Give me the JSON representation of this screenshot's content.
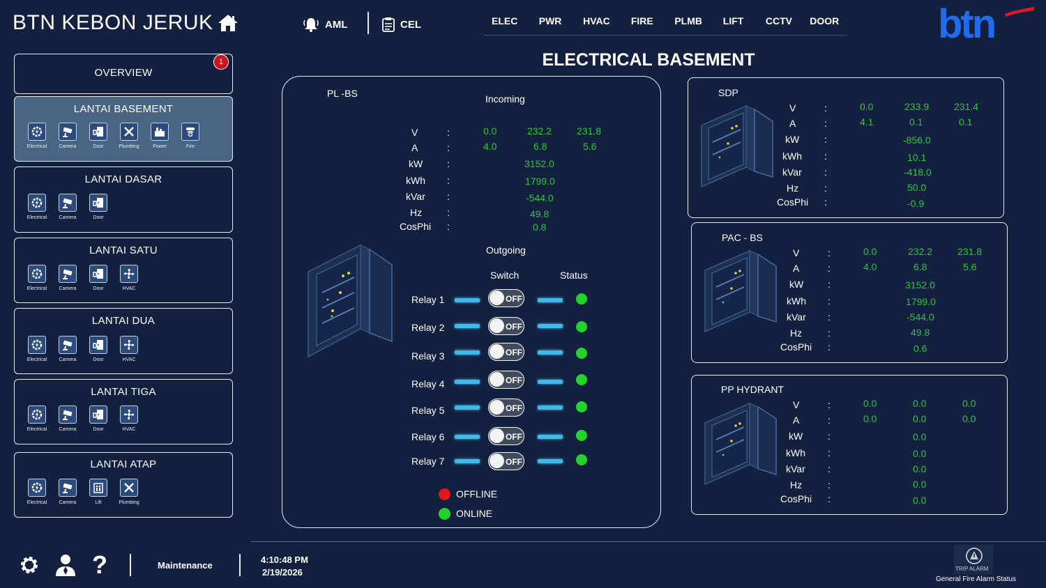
{
  "header": {
    "site_title": "BTN KEBON JERUK",
    "aml_label": "AML",
    "cel_label": "CEL",
    "nav": [
      "ELEC",
      "PWR",
      "HVAC",
      "FIRE",
      "PLMB",
      "LIFT",
      "CCTV",
      "DOOR"
    ],
    "logo_text": "btn"
  },
  "sidebar": {
    "overview": {
      "label": "OVERVIEW",
      "badge": "1"
    },
    "floors": [
      {
        "title": "LANTAI BASEMENT",
        "icons": [
          "Electrical",
          "Camera",
          "Door",
          "Plumbing",
          "Power",
          "Fire"
        ]
      },
      {
        "title": "LANTAI DASAR",
        "icons": [
          "Electrical",
          "Camera",
          "Door"
        ]
      },
      {
        "title": "LANTAI SATU",
        "icons": [
          "Electrical",
          "Camera",
          "Door",
          "HVAC"
        ]
      },
      {
        "title": "LANTAI DUA",
        "icons": [
          "Electrical",
          "Camera",
          "Door",
          "HVAC"
        ]
      },
      {
        "title": "LANTAI TIGA",
        "icons": [
          "Electrical",
          "Camera",
          "Door",
          "HVAC"
        ]
      },
      {
        "title": "LANTAI ATAP",
        "icons": [
          "Electrical",
          "Camera",
          "Lift",
          "Plumbing"
        ]
      }
    ]
  },
  "main": {
    "title": "ELECTRICAL BASEMENT",
    "plbs": {
      "name": "PL -BS",
      "incoming_label": "Incoming",
      "outgoing_label": "Outgoing",
      "switch_label": "Switch",
      "status_label": "Status",
      "labels": [
        "V",
        "A",
        "kW",
        "kWh",
        "kVar",
        "Hz",
        "CosPhi"
      ],
      "V": [
        "0.0",
        "232.2",
        "231.8"
      ],
      "A": [
        "4.0",
        "6.8",
        "5.6"
      ],
      "kW": "3152.0",
      "kWh": "1799.0",
      "kVar": "-544.0",
      "Hz": "49.8",
      "CosPhi": "0.8",
      "relays": [
        {
          "name": "Relay 1",
          "switch": "OFF"
        },
        {
          "name": "Relay 2",
          "switch": "OFF"
        },
        {
          "name": "Relay 3",
          "switch": "OFF"
        },
        {
          "name": "Relay 4",
          "switch": "OFF"
        },
        {
          "name": "Relay 5",
          "switch": "OFF"
        },
        {
          "name": "Relay 6",
          "switch": "OFF"
        },
        {
          "name": "Relay 7",
          "switch": "OFF"
        }
      ],
      "legend_offline": "OFFLINE",
      "legend_online": "ONLINE"
    },
    "sdp": {
      "name": "SDP",
      "V": [
        "0.0",
        "233.9",
        "231.4"
      ],
      "A": [
        "4.1",
        "0.1",
        "0.1"
      ],
      "kW": "-856.0",
      "kWh": "10.1",
      "kVar": "-418.0",
      "Hz": "50.0",
      "CosPhi": "-0.9"
    },
    "pac": {
      "name": "PAC - BS",
      "V": [
        "0.0",
        "232.2",
        "231.8"
      ],
      "A": [
        "4.0",
        "6.8",
        "5.6"
      ],
      "kW": "3152.0",
      "kWh": "1799.0",
      "kVar": "-544.0",
      "Hz": "49.8",
      "CosPhi": "0.6"
    },
    "hydrant": {
      "name": "PP HYDRANT",
      "V": [
        "0.0",
        "0.0",
        "0.0"
      ],
      "A": [
        "0.0",
        "0.0",
        "0.0"
      ],
      "kW": "0.0",
      "kWh": "0.0",
      "kVar": "0.0",
      "Hz": "0.0",
      "CosPhi": "0.0"
    }
  },
  "footer": {
    "maintenance_label": "Maintenance",
    "time": "4:10:48 PM",
    "date": "2/19/2026",
    "trip_alarm_label": "TRIP ALARM",
    "fire_alarm_status": "General Fire Alarm Status"
  },
  "colors": {
    "background": "#13203f",
    "active_card": "#4a6484",
    "value_green": "#27c93a",
    "status_online": "#22d42a",
    "status_offline": "#e01818",
    "relay_bar": "#42b8e8",
    "logo_blue": "#1e6cf0",
    "logo_red": "#e01a22"
  }
}
